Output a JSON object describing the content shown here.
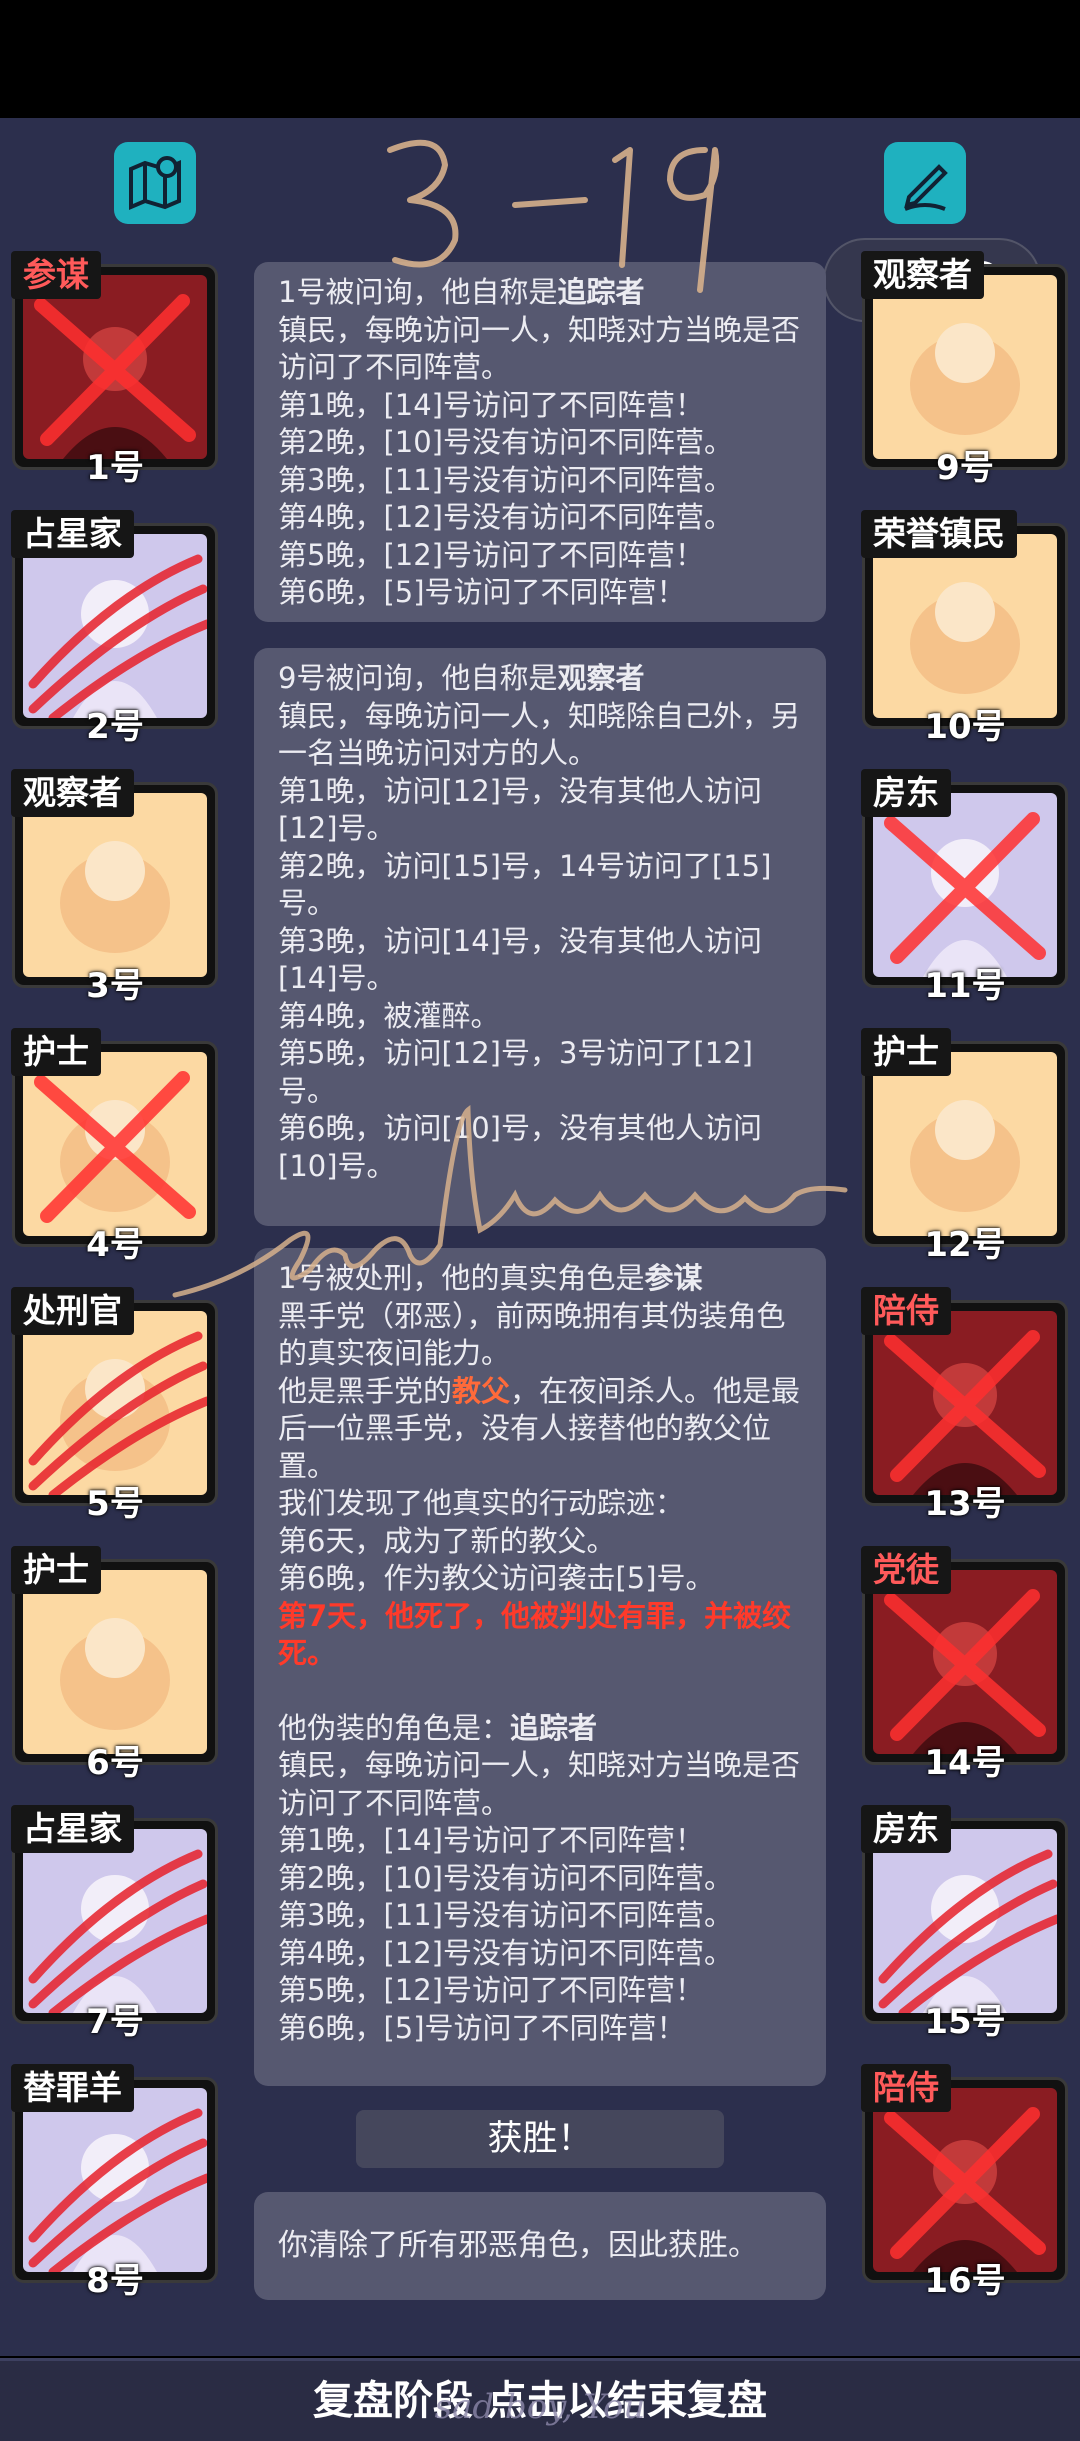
{
  "players_left": [
    {
      "num": "1号",
      "role": "参谋",
      "bg": "red",
      "dead": "x",
      "dark": true
    },
    {
      "num": "2号",
      "role": "占星家",
      "bg": "lav",
      "dead": "claw"
    },
    {
      "num": "3号",
      "role": "观察者",
      "bg": "peach",
      "dead": ""
    },
    {
      "num": "4号",
      "role": "护士",
      "bg": "peach",
      "dead": "x"
    },
    {
      "num": "5号",
      "role": "处刑官",
      "bg": "peach",
      "dead": "claw"
    },
    {
      "num": "6号",
      "role": "护士",
      "bg": "peach",
      "dead": ""
    },
    {
      "num": "7号",
      "role": "占星家",
      "bg": "lav",
      "dead": "claw"
    },
    {
      "num": "8号",
      "role": "替罪羊",
      "bg": "lav",
      "dead": "claw"
    }
  ],
  "players_right": [
    {
      "num": "9号",
      "role": "观察者",
      "bg": "peach",
      "dead": ""
    },
    {
      "num": "10号",
      "role": "荣誉镇民",
      "bg": "peach",
      "dead": ""
    },
    {
      "num": "11号",
      "role": "房东",
      "bg": "lav",
      "dead": "x"
    },
    {
      "num": "12号",
      "role": "护士",
      "bg": "peach",
      "dead": ""
    },
    {
      "num": "13号",
      "role": "陪侍",
      "bg": "red",
      "dead": "x",
      "dark": true
    },
    {
      "num": "14号",
      "role": "党徒",
      "bg": "red",
      "dead": "x",
      "dark": true
    },
    {
      "num": "15号",
      "role": "房东",
      "bg": "lav",
      "dead": "claw"
    },
    {
      "num": "16号",
      "role": "陪侍",
      "bg": "red",
      "dead": "x",
      "dark": true
    }
  ],
  "log1": {
    "head": "1号被问询，他自称是",
    "head_role": "追踪者",
    "lines": [
      "镇民，每晚访问一人，知晓对方当晚是否访问了不同阵营。",
      "第1晚，[14]号访问了不同阵营！",
      "第2晚，[10]号没有访问不同阵营。",
      "第3晚，[11]号没有访问不同阵营。",
      "第4晚，[12]号没有访问不同阵营。",
      "第5晚，[12]号访问了不同阵营！",
      "第6晚，[5]号访问了不同阵营！"
    ]
  },
  "log2": {
    "head": "9号被问询，他自称是",
    "head_role": "观察者",
    "lines": [
      "镇民，每晚访问一人，知晓除自己外，另一名当晚访问对方的人。",
      "第1晚，访问[12]号，没有其他人访问[12]号。",
      "第2晚，访问[15]号，14号访问了[15]号。",
      "第3晚，访问[14]号，没有其他人访问[14]号。",
      "第4晚，被灌醉。",
      "第5晚，访问[12]号，3号访问了[12]号。",
      "第6晚，访问[10]号，没有其他人访问[10]号。"
    ]
  },
  "log3": {
    "head": "1号被处刑，他的真实角色是",
    "head_role": "参谋",
    "line1": "黑手党（邪恶），前两晚拥有其伪装角色的真实夜间能力。",
    "line2a": "他是黑手党的",
    "line2b": "教父",
    "line2c": "，在夜间杀人。他是最后一位黑手党，没有人接替他的教父位置。",
    "line3": "我们发现了他真实的行动踪迹：",
    "line4": "第6天，成为了新的教父。",
    "line5": "第6晚，作为教父访问袭击[5]号。",
    "death": "第7天，他死了，他被判处有罪，并被绞死。",
    "disguise_head": "他伪装的角色是：",
    "disguise_role": "追踪者",
    "lines": [
      "镇民，每晚访问一人，知晓对方当晚是否访问了不同阵营。",
      "第1晚，[14]号访问了不同阵营！",
      "第2晚，[10]号没有访问不同阵营。",
      "第3晚，[11]号没有访问不同阵营。",
      "第4晚，[12]号没有访问不同阵营。",
      "第5晚，[12]号访问了不同阵营！",
      "第6晚，[5]号访问了不同阵营！"
    ]
  },
  "win_label": "获胜！",
  "win_text": "你清除了所有邪恶角色，因此获胜。",
  "bottom_bar": "复盘阶段 点击以结束复盘",
  "handwriting_top": "3-19",
  "handwriting_bottom": "sad boy, You",
  "colors": {
    "board": "#2c2f4d",
    "accent": "#1fb1bf",
    "danger": "#ff3a2a",
    "log_bg": "#565870"
  },
  "icons": {
    "map": "map-pin-icon",
    "notes": "pencil-note-icon"
  }
}
